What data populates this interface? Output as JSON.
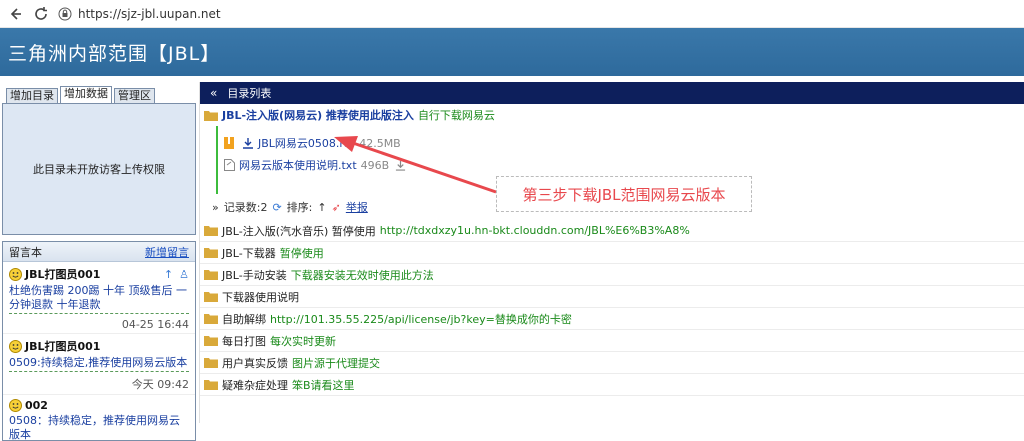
{
  "browser": {
    "url": "https://sjz-jbl.uupan.net"
  },
  "banner": {
    "title": "三角洲内部范围【JBL】"
  },
  "left": {
    "tabs": [
      "增加目录",
      "增加数据",
      "管理区"
    ],
    "panel_text": "此目录未开放访客上传权限",
    "guestbook": {
      "title": "留言本",
      "new_link": "新增留言",
      "messages": [
        {
          "name": "JBL打图员001",
          "text": "杜绝伤害踢 200踢 十年 顶级售后 一分钟退款 十年退款",
          "time": "04-25 16:44"
        },
        {
          "name": "JBL打图员001",
          "text": "0509:持续稳定,推荐使用网易云版本",
          "time": "今天 09:42"
        },
        {
          "name": "002",
          "text": "0508：持续稳定，推荐使用网易云版本",
          "time": ""
        }
      ]
    }
  },
  "main": {
    "header": "目录列表",
    "first_folder": {
      "name": "JBL-注入版(网易云) 推荐使用此版注入",
      "note": "自行下载网易云"
    },
    "files": [
      {
        "name": "JBL网易云0508.rar",
        "size": "42.5MB"
      },
      {
        "name": "网易云版本使用说明.txt",
        "size": "496B"
      }
    ],
    "stats": {
      "count": "记录数:2",
      "sort": "排序:",
      "report": "举报"
    },
    "callout": "第三步下载JBL范围网易云版本",
    "folders": [
      {
        "name": "JBL-注入版(汽水音乐) 暂停使用",
        "note": "http://tdxdxzy1u.hn-bkt.clouddn.com/JBL%E6%B3%A8%"
      },
      {
        "name": "JBL-下载器",
        "note": "暂停使用"
      },
      {
        "name": "JBL-手动安装",
        "note": "下载器安装无效时使用此方法"
      },
      {
        "name": "下载器使用说明",
        "note": ""
      },
      {
        "name": "自助解绑",
        "note": "http://101.35.55.225/api/license/jb?key=替换成你的卡密"
      },
      {
        "name": "每日打图",
        "note": "每次实时更新"
      },
      {
        "name": "用户真实反馈",
        "note": "图片源于代理提交"
      },
      {
        "name": "疑难杂症处理",
        "note": "笨B请看这里"
      }
    ]
  },
  "colors": {
    "banner": "#2e6a9c",
    "header": "#0d1f5c",
    "accent_green": "#1a8a1a",
    "callout_red": "#e8484d"
  }
}
